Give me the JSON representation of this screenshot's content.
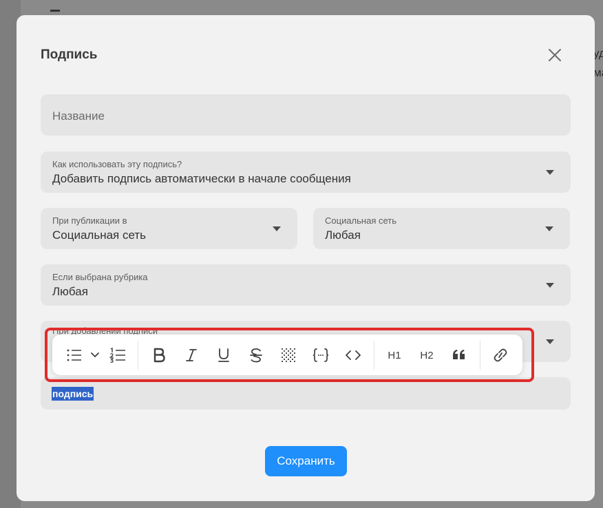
{
  "background": {
    "text_line1": "уд",
    "text_line2": "ма"
  },
  "modal": {
    "title": "Подпись"
  },
  "form": {
    "name_placeholder": "Название",
    "usage": {
      "label": "Как использовать эту подпись?",
      "value": "Добавить подпись автоматически в начале сообщения"
    },
    "publish_in": {
      "label": "При публикации в",
      "value": "Социальная сеть"
    },
    "social_network": {
      "label": "Социальная сеть",
      "value": "Любая"
    },
    "rubric": {
      "label": "Если выбрана рубрика",
      "value": "Любая"
    },
    "on_add": {
      "label": "При добавлении подписи"
    },
    "editor": {
      "selected_text": "подпись"
    }
  },
  "toolbar": {
    "h1_label": "H1",
    "h2_label": "H2",
    "icons": [
      "bullet-list-icon",
      "chevron-down-icon",
      "numbered-list-icon",
      "bold-icon",
      "italic-icon",
      "underline-icon",
      "strikethrough-icon",
      "spoiler-icon",
      "variable-icon",
      "code-icon",
      "quote-icon",
      "link-icon"
    ]
  },
  "actions": {
    "save_label": "Сохранить"
  },
  "colors": {
    "accent": "#1e8ffb",
    "selection": "#2f63c8",
    "highlight": "#e02b2b"
  }
}
